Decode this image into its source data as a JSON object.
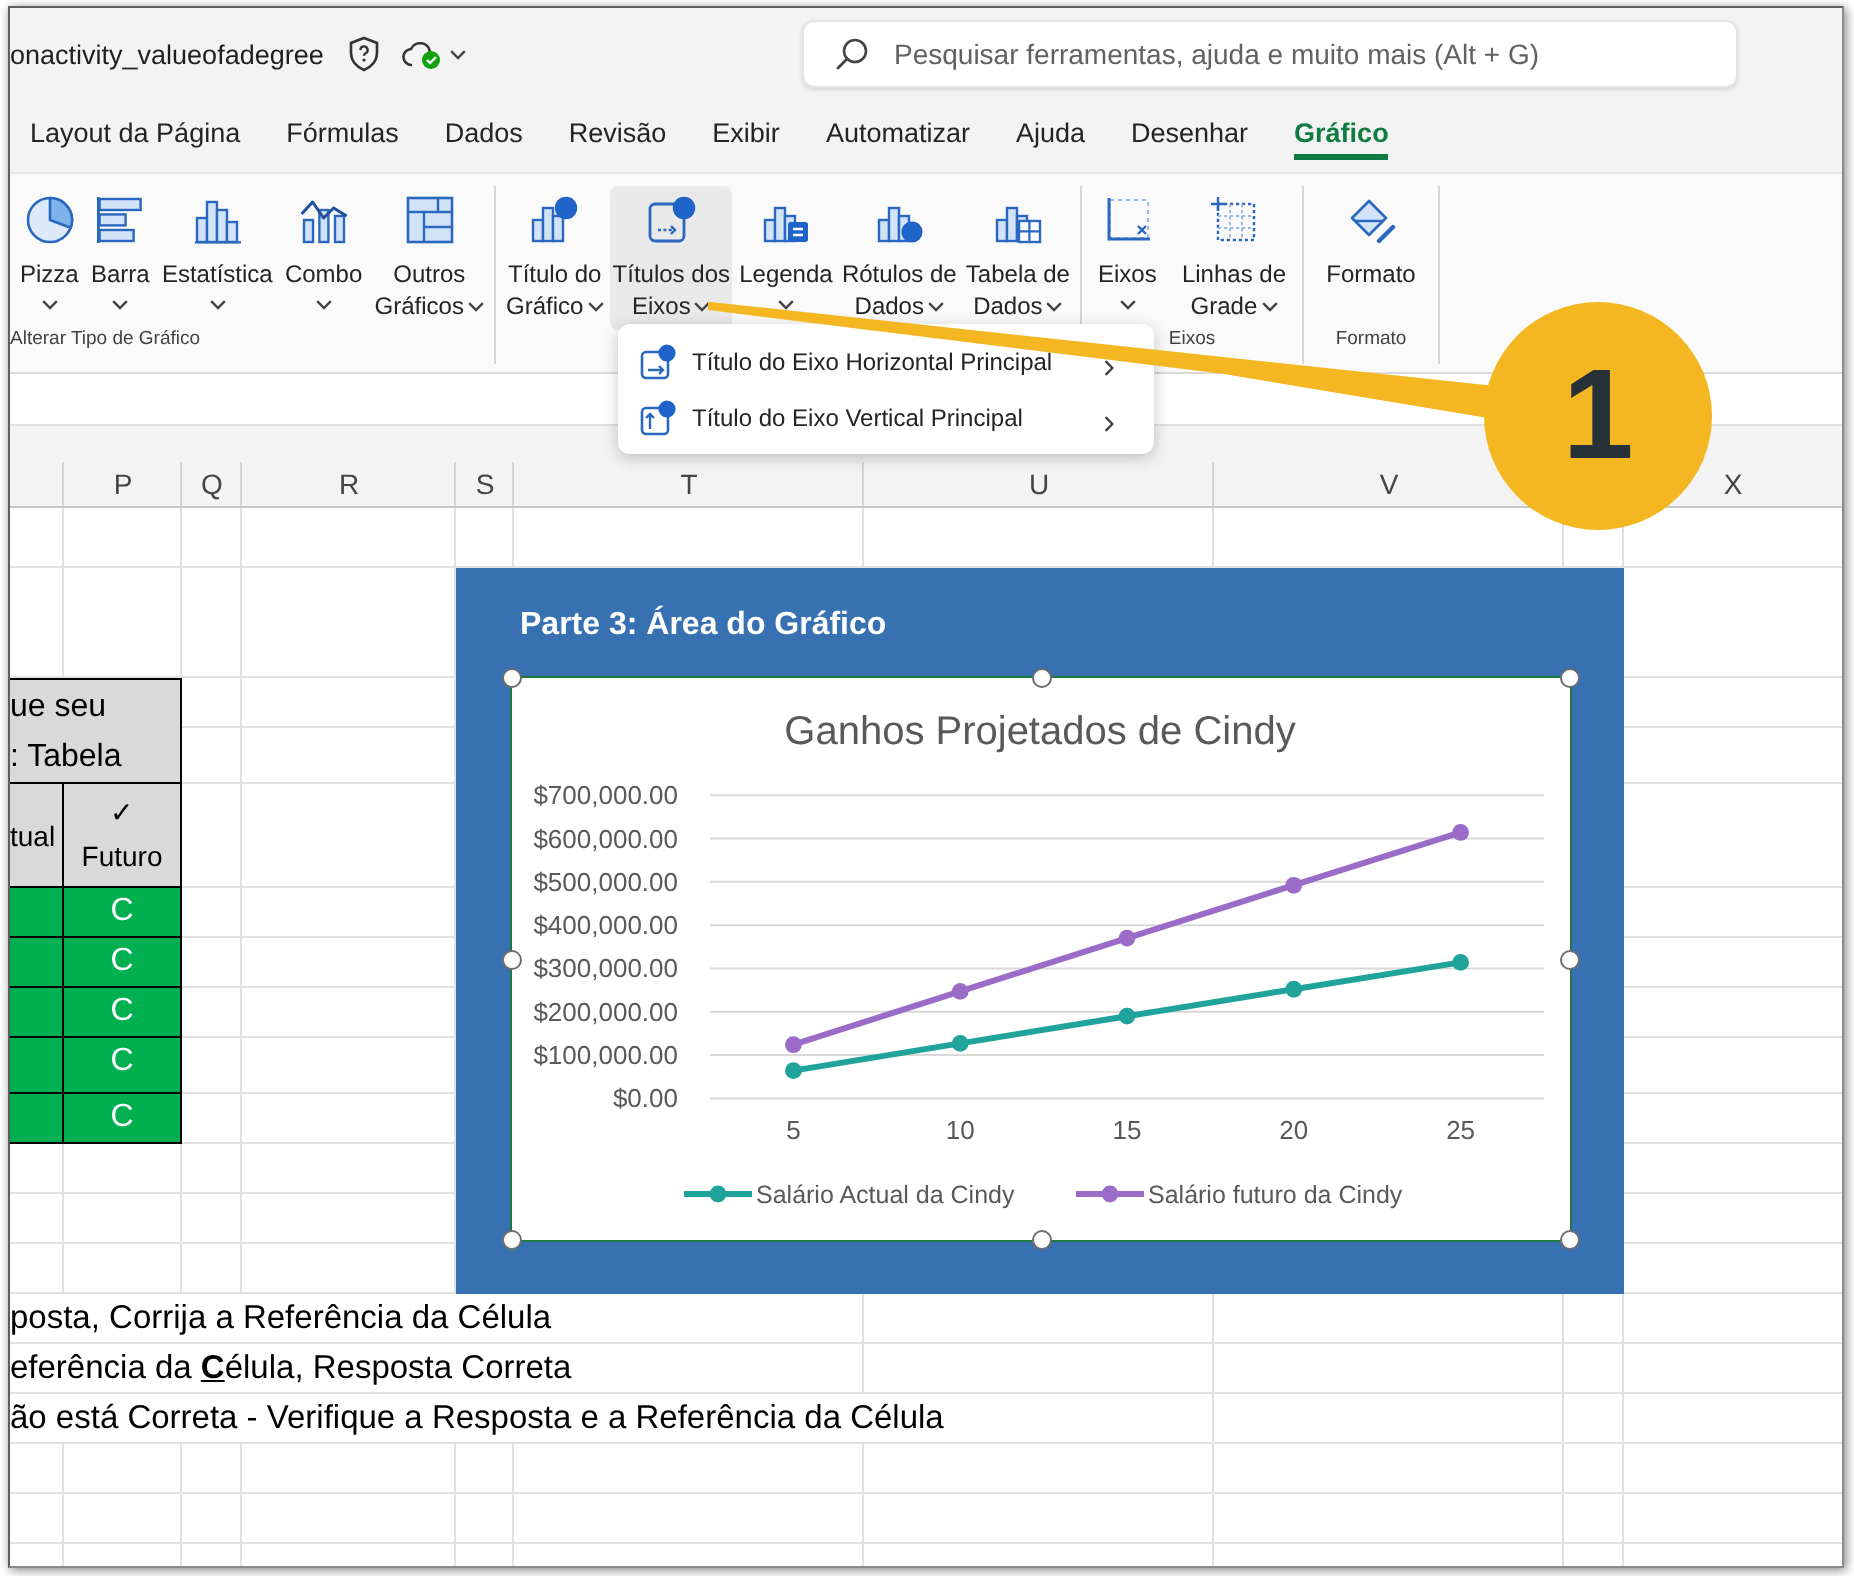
{
  "title_bar": {
    "file_name": "onactivity_valueofadegree",
    "search": {
      "placeholder": "Pesquisar ferramentas, ajuda e muito mais (Alt + G)"
    }
  },
  "tabs": [
    {
      "label": "Layout da Página",
      "selected": false
    },
    {
      "label": "Fórmulas",
      "selected": false
    },
    {
      "label": "Dados",
      "selected": false
    },
    {
      "label": "Revisão",
      "selected": false
    },
    {
      "label": "Exibir",
      "selected": false
    },
    {
      "label": "Automatizar",
      "selected": false
    },
    {
      "label": "Ajuda",
      "selected": false
    },
    {
      "label": "Desenhar",
      "selected": false
    },
    {
      "label": "Gráfico",
      "selected": true
    }
  ],
  "ribbon": {
    "groups": [
      {
        "label": "Alterar Tipo de Gráfico",
        "buttons": [
          {
            "label": "Pizza",
            "dropdown": true,
            "expanded": false
          },
          {
            "label": "Barra",
            "dropdown": true,
            "expanded": false
          },
          {
            "label": "Estatística",
            "dropdown": true,
            "expanded": false
          },
          {
            "label": "Combo",
            "dropdown": true,
            "expanded": false
          },
          {
            "label": "Outros\nGráficos",
            "dropdown": true,
            "expanded": false
          }
        ]
      },
      {
        "buttons": [
          {
            "label": "Título do\nGráfico",
            "dropdown": true,
            "expanded": false
          },
          {
            "label": "Títulos dos\nEixos",
            "dropdown": true,
            "expanded": true
          },
          {
            "label": "Legenda",
            "dropdown": true,
            "expanded": false
          },
          {
            "label": "Rótulos de\nDados",
            "dropdown": true,
            "expanded": false
          },
          {
            "label": "Tabela de\nDados",
            "dropdown": true,
            "expanded": false
          }
        ]
      },
      {
        "label": "Eixos",
        "buttons": [
          {
            "label": "Eixos",
            "dropdown": true,
            "expanded": false
          },
          {
            "label": "Linhas de\nGrade",
            "dropdown": true,
            "expanded": false
          }
        ]
      },
      {
        "label": "Formato",
        "buttons": [
          {
            "label": "Formato",
            "dropdown": false,
            "expanded": false
          }
        ]
      }
    ]
  },
  "axis_titles_menu": {
    "items": [
      {
        "label": "Título do Eixo Horizontal Principal",
        "submenu": true
      },
      {
        "label": "Título do Eixo Vertical Principal",
        "submenu": true
      }
    ]
  },
  "sheet": {
    "columns": [
      {},
      {
        "header": "P"
      },
      {
        "header": "Q"
      },
      {
        "header": "R"
      },
      {
        "header": "S"
      },
      {
        "header": "T"
      },
      {
        "header": "U"
      },
      {
        "header": "V"
      },
      {},
      {
        "header": "X"
      }
    ],
    "check_table": {
      "title": "ue seu\n: Tabela",
      "headers": [
        "tual",
        "✓\nFuturo"
      ],
      "rows": [
        {
          "value": "C",
          "correct": true
        },
        {
          "value": "C",
          "correct": true
        },
        {
          "value": "C",
          "correct": true
        },
        {
          "value": "C",
          "correct": true
        },
        {
          "value": "C",
          "correct": true
        }
      ]
    },
    "notes": [
      "posta, Corrija a Referência da Célula",
      "eferência da **C**élula, Resposta Correta",
      "ão está Correta - Verifique a Resposta e a Referência da Célula"
    ]
  },
  "chart_object": {
    "heading": "Parte 3: Área do Gráfico",
    "selected": true,
    "chart_data": {
      "type": "line",
      "title": "Ganhos Projetados de Cindy",
      "categories": [
        "5",
        "10",
        "15",
        "20",
        "25"
      ],
      "series": [
        {
          "name": "Salário Actual da Cindy",
          "color": "#1fa39b",
          "marker": "circle",
          "values": [
            64000,
            127000,
            190000,
            252000,
            314000
          ]
        },
        {
          "name": "Salário futuro da Cindy",
          "color": "#9b6bc8",
          "marker": "circle",
          "values": [
            124000,
            247000,
            370000,
            492000,
            614000
          ]
        }
      ],
      "ylim": [
        0,
        700000
      ],
      "yticks": [
        {
          "value": 0,
          "label": "$0.00"
        },
        {
          "value": 100000,
          "label": "$100,000.00"
        },
        {
          "value": 200000,
          "label": "$200,000.00"
        },
        {
          "value": 300000,
          "label": "$300,000.00"
        },
        {
          "value": 400000,
          "label": "$400,000.00"
        },
        {
          "value": 500000,
          "label": "$500,000.00"
        },
        {
          "value": 600000,
          "label": "$600,000.00"
        },
        {
          "value": 700000,
          "label": "$700,000.00"
        }
      ],
      "grid": true,
      "legend": "bottom"
    }
  },
  "callout": {
    "number": "1"
  }
}
